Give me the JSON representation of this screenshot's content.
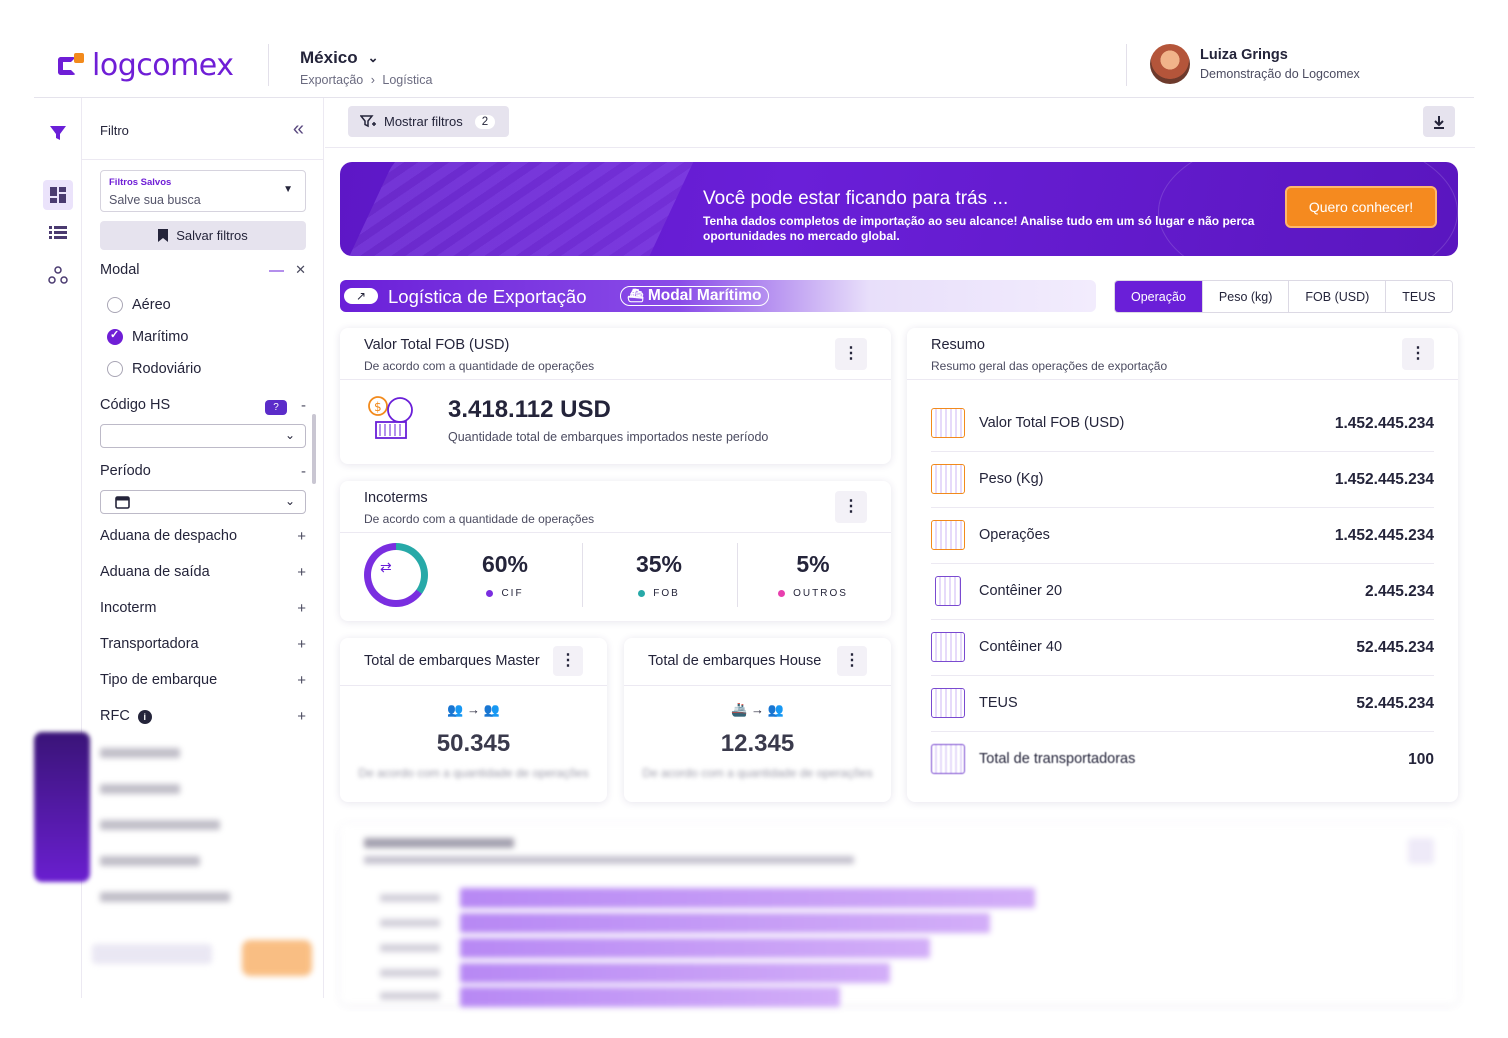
{
  "header": {
    "logo_text": "logcomex",
    "country": "México",
    "breadcrumb_1": "Exportação",
    "breadcrumb_sep": "›",
    "breadcrumb_2": "Logística",
    "user_name": "Luiza Grings",
    "user_subtitle": "Demonstração do Logcomex"
  },
  "filter_panel": {
    "title": "Filtro",
    "saved_label": "Filtros Salvos",
    "saved_placeholder": "Salve sua busca",
    "save_button": "Salvar filtros",
    "modal_label": "Modal",
    "modal_options": [
      "Aéreo",
      "Marítimo",
      "Rodoviário"
    ],
    "modal_selected": "Marítimo",
    "hs_label": "Código HS",
    "hs_badge": "?",
    "period_label": "Período",
    "sections": [
      "Aduana de despacho",
      "Aduana de saída",
      "Incoterm",
      "Transportadora",
      "Tipo de embarque",
      "RFC"
    ],
    "minus": "—",
    "close": "✕",
    "dash": "-",
    "plus": "+"
  },
  "topbar": {
    "show_filters": "Mostrar filtros",
    "filter_count": "2"
  },
  "banner": {
    "title": "Você pode estar ficando para trás ...",
    "text": "Tenha dados completos de importação ao seu alcance! Analise tudo em um só lugar e não perca oportunidades no mercado global.",
    "cta": "Quero conhecer!"
  },
  "section": {
    "title": "Logística de Exportação",
    "badge": "Modal Marítimo"
  },
  "tabs": [
    "Operação",
    "Peso (kg)",
    "FOB (USD)",
    "TEUS"
  ],
  "fob_card": {
    "title": "Valor Total FOB (USD)",
    "subtitle": "De acordo com a quantidade de operações",
    "value": "3.418.112 USD",
    "description": "Quantidade total de embarques importados neste período"
  },
  "incoterms_card": {
    "title": "Incoterms",
    "subtitle": "De acordo com a quantidade de operações",
    "items": [
      {
        "pct": "60%",
        "label": "CIF",
        "color": "#7a2ee0"
      },
      {
        "pct": "35%",
        "label": "FOB",
        "color": "#27a9a8"
      },
      {
        "pct": "5%",
        "label": "OUTROS",
        "color": "#e83fae"
      }
    ]
  },
  "master_card": {
    "title": "Total de embarques Master",
    "value": "50.345",
    "subtitle": "De acordo com a quantidade de operações"
  },
  "house_card": {
    "title": "Total de embarques House",
    "value": "12.345",
    "subtitle": "De acordo com a quantidade de operações"
  },
  "summary_card": {
    "title": "Resumo",
    "subtitle": "Resumo geral das operações de exportação",
    "rows": [
      {
        "label": "Valor Total FOB (USD)",
        "value": "1.452.445.234",
        "icon": "money-container-icon"
      },
      {
        "label": "Peso (Kg)",
        "value": "1.452.445.234",
        "icon": "scale-icon"
      },
      {
        "label": "Operações",
        "value": "1.452.445.234",
        "icon": "operations-icon"
      },
      {
        "label": "Contêiner 20",
        "value": "2.445.234",
        "icon": "container-20-icon"
      },
      {
        "label": "Contêiner 40",
        "value": "52.445.234",
        "icon": "container-40-icon"
      },
      {
        "label": "TEUS",
        "value": "52.445.234",
        "icon": "teus-icon"
      },
      {
        "label": "Total de transportadoras",
        "value": "100",
        "icon": "carriers-icon"
      }
    ]
  },
  "colors": {
    "brand_purple": "#6a1fd8",
    "brand_orange": "#f58a1f"
  }
}
